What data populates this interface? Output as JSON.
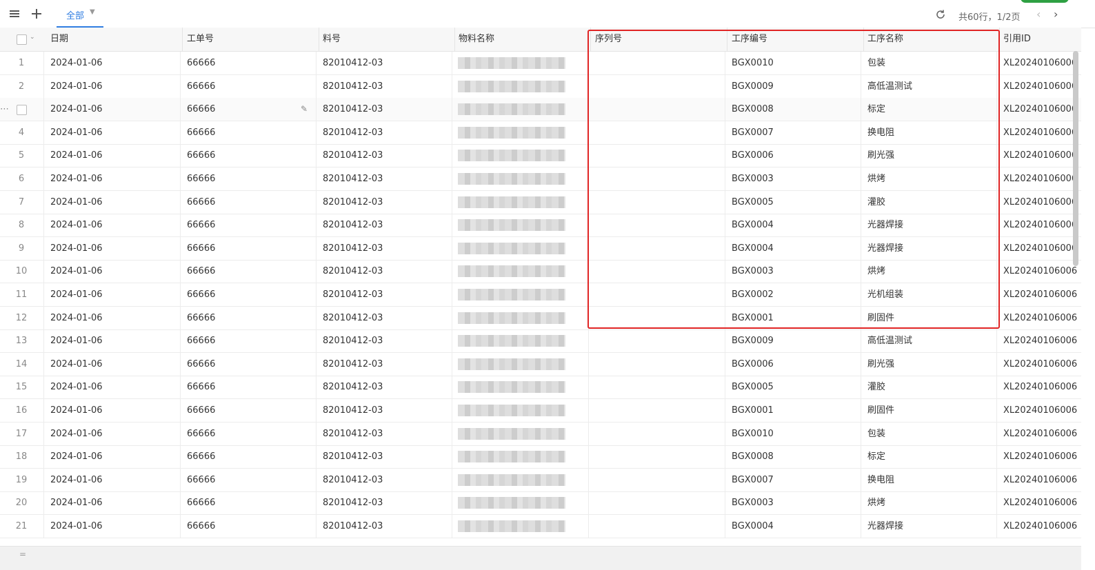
{
  "toolbar": {
    "tab_all": "全部",
    "pager_text": "共60行，1/2页"
  },
  "columns": {
    "date": "日期",
    "order_no": "工单号",
    "part_no": "料号",
    "material_name": "物料名称",
    "serial_no": "序列号",
    "process_code": "工序编号",
    "process_name": "工序名称",
    "ref_id": "引用ID"
  },
  "rows": [
    {
      "n": "1",
      "date": "2024-01-06",
      "order": "66666",
      "part": "82010412-03",
      "code": "BGX0010",
      "name": "包装",
      "ref": "XL20240106006"
    },
    {
      "n": "2",
      "date": "2024-01-06",
      "order": "66666",
      "part": "82010412-03",
      "code": "BGX0009",
      "name": "高低温测试",
      "ref": "XL20240106006"
    },
    {
      "n": "3",
      "date": "2024-01-06",
      "order": "66666",
      "part": "82010412-03",
      "code": "BGX0008",
      "name": "标定",
      "ref": "XL20240106006"
    },
    {
      "n": "4",
      "date": "2024-01-06",
      "order": "66666",
      "part": "82010412-03",
      "code": "BGX0007",
      "name": "换电阻",
      "ref": "XL20240106006"
    },
    {
      "n": "5",
      "date": "2024-01-06",
      "order": "66666",
      "part": "82010412-03",
      "code": "BGX0006",
      "name": "刷光强",
      "ref": "XL20240106006"
    },
    {
      "n": "6",
      "date": "2024-01-06",
      "order": "66666",
      "part": "82010412-03",
      "code": "BGX0003",
      "name": "烘烤",
      "ref": "XL20240106006"
    },
    {
      "n": "7",
      "date": "2024-01-06",
      "order": "66666",
      "part": "82010412-03",
      "code": "BGX0005",
      "name": "灌胶",
      "ref": "XL20240106006"
    },
    {
      "n": "8",
      "date": "2024-01-06",
      "order": "66666",
      "part": "82010412-03",
      "code": "BGX0004",
      "name": "光器焊接",
      "ref": "XL20240106006"
    },
    {
      "n": "9",
      "date": "2024-01-06",
      "order": "66666",
      "part": "82010412-03",
      "code": "BGX0004",
      "name": "光器焊接",
      "ref": "XL20240106006"
    },
    {
      "n": "10",
      "date": "2024-01-06",
      "order": "66666",
      "part": "82010412-03",
      "code": "BGX0003",
      "name": "烘烤",
      "ref": "XL20240106006"
    },
    {
      "n": "11",
      "date": "2024-01-06",
      "order": "66666",
      "part": "82010412-03",
      "code": "BGX0002",
      "name": "光机组装",
      "ref": "XL20240106006"
    },
    {
      "n": "12",
      "date": "2024-01-06",
      "order": "66666",
      "part": "82010412-03",
      "code": "BGX0001",
      "name": "刷固件",
      "ref": "XL20240106006"
    },
    {
      "n": "13",
      "date": "2024-01-06",
      "order": "66666",
      "part": "82010412-03",
      "code": "BGX0009",
      "name": "高低温测试",
      "ref": "XL20240106006"
    },
    {
      "n": "14",
      "date": "2024-01-06",
      "order": "66666",
      "part": "82010412-03",
      "code": "BGX0006",
      "name": "刷光强",
      "ref": "XL20240106006"
    },
    {
      "n": "15",
      "date": "2024-01-06",
      "order": "66666",
      "part": "82010412-03",
      "code": "BGX0005",
      "name": "灌胶",
      "ref": "XL20240106006"
    },
    {
      "n": "16",
      "date": "2024-01-06",
      "order": "66666",
      "part": "82010412-03",
      "code": "BGX0001",
      "name": "刷固件",
      "ref": "XL20240106006"
    },
    {
      "n": "17",
      "date": "2024-01-06",
      "order": "66666",
      "part": "82010412-03",
      "code": "BGX0010",
      "name": "包装",
      "ref": "XL20240106006"
    },
    {
      "n": "18",
      "date": "2024-01-06",
      "order": "66666",
      "part": "82010412-03",
      "code": "BGX0008",
      "name": "标定",
      "ref": "XL20240106006"
    },
    {
      "n": "19",
      "date": "2024-01-06",
      "order": "66666",
      "part": "82010412-03",
      "code": "BGX0007",
      "name": "换电阻",
      "ref": "XL20240106006"
    },
    {
      "n": "20",
      "date": "2024-01-06",
      "order": "66666",
      "part": "82010412-03",
      "code": "BGX0003",
      "name": "烘烤",
      "ref": "XL20240106006"
    },
    {
      "n": "21",
      "date": "2024-01-06",
      "order": "66666",
      "part": "82010412-03",
      "code": "BGX0004",
      "name": "光器焊接",
      "ref": "XL20240106006"
    }
  ],
  "icons": {
    "menu": "menu-icon",
    "add": "plus-icon",
    "refresh": "refresh-icon",
    "prev": "chevron-left-icon",
    "next": "chevron-right-icon"
  },
  "colors": {
    "accent": "#2f7de1",
    "highlight_box": "#e02424"
  }
}
